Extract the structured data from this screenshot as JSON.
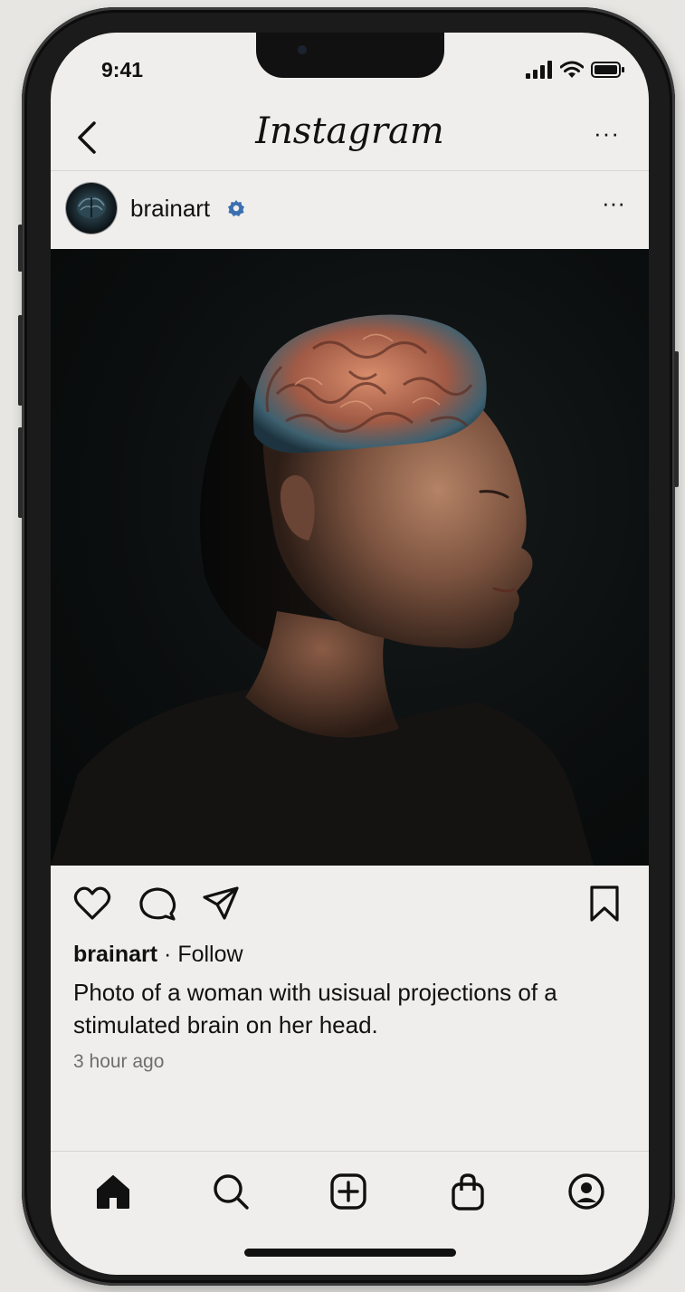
{
  "status_bar": {
    "time": "9:41",
    "icons": [
      "signal-icon",
      "wifi-icon",
      "battery-icon"
    ]
  },
  "top_bar": {
    "back_icon": "chevron-left-icon",
    "logo_text": "Instagram",
    "more_icon": "more-horizontal-icon",
    "more_label": "···"
  },
  "post": {
    "username": "brainart",
    "verified": true,
    "more_label": "···",
    "image_subject": "woman-with-glowing-brain-portrait",
    "actions": [
      "heart-icon",
      "comment-icon",
      "share-icon",
      "bookmark-icon"
    ],
    "caption_username": "brainart",
    "follow_label": "· Follow",
    "caption": "Photo of a woman with usisual projections of a stimulated brain on her head.",
    "time_ago": "3 hour ago"
  },
  "tab_bar": {
    "items": [
      "home-icon",
      "search-icon",
      "create-post-icon",
      "shop-icon",
      "profile-icon"
    ]
  },
  "colors": {
    "screen_bg": "#efeeec",
    "text": "#111111",
    "muted": "#6e6e6e",
    "verified_blue": "#3b6fb0",
    "photo_bg": "#0b0e0e"
  }
}
